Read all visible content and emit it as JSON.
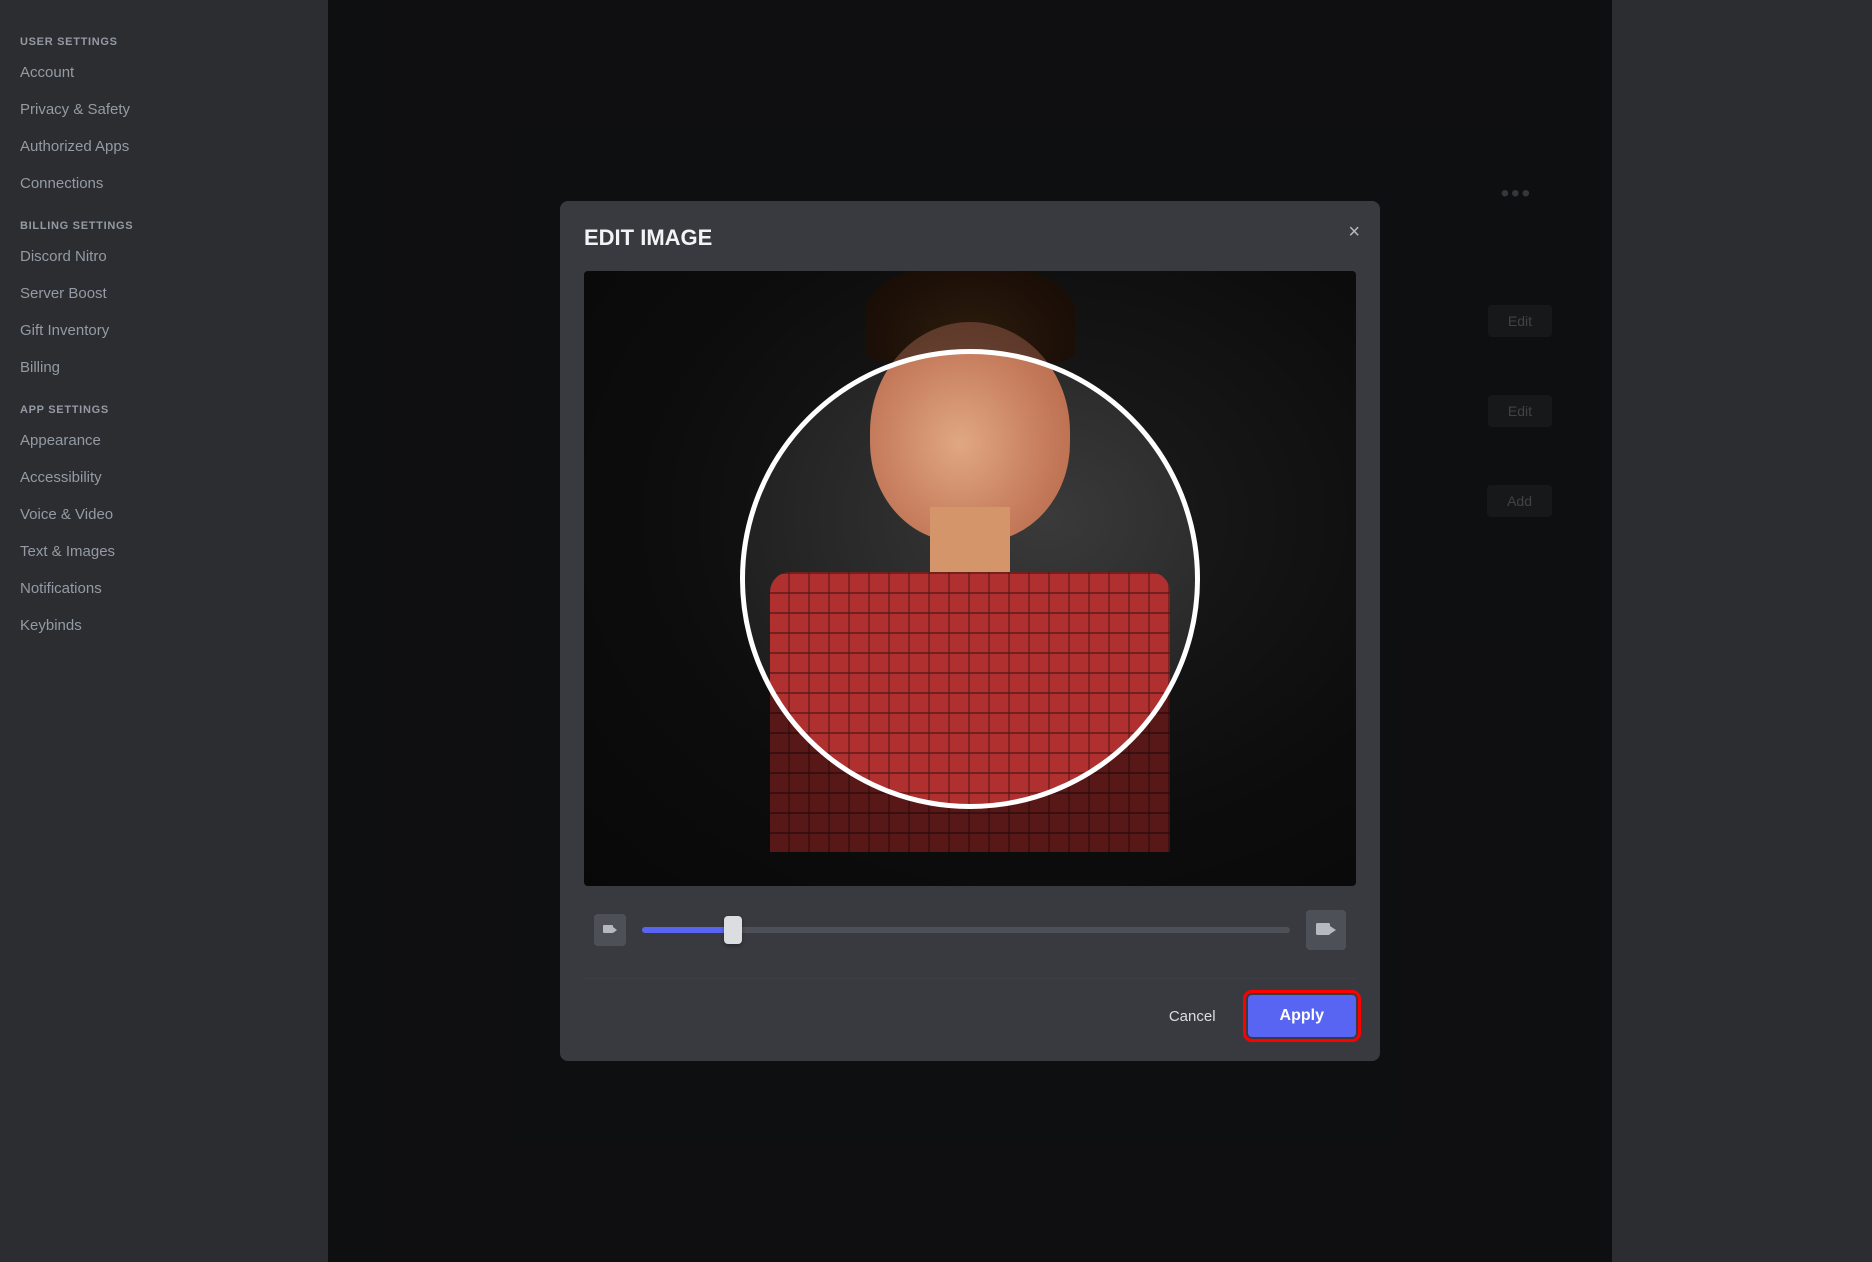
{
  "sidebar": {
    "sections": [
      {
        "label": "USER SETTINGS",
        "items": [
          {
            "id": "account",
            "label": "Account",
            "active": false
          },
          {
            "id": "privacy",
            "label": "Privacy & Safety",
            "active": false
          },
          {
            "id": "apps",
            "label": "Authorized Apps",
            "active": false
          },
          {
            "id": "connections",
            "label": "Connections",
            "active": false
          }
        ]
      },
      {
        "label": "BILLING SETTINGS",
        "items": [
          {
            "id": "nitro",
            "label": "Discord Nitro",
            "active": false
          },
          {
            "id": "boost",
            "label": "Server Boost",
            "active": false
          },
          {
            "id": "inventory",
            "label": "Gift Inventory",
            "active": false
          },
          {
            "id": "billing",
            "label": "Billing",
            "active": false
          }
        ]
      },
      {
        "label": "APP SETTINGS",
        "items": [
          {
            "id": "appearance",
            "label": "Appearance",
            "active": false
          },
          {
            "id": "accessibility",
            "label": "Accessibility",
            "active": false
          },
          {
            "id": "voice",
            "label": "Voice & Video",
            "active": false
          },
          {
            "id": "text",
            "label": "Text & Images",
            "active": false
          },
          {
            "id": "notifications",
            "label": "Notifications",
            "active": false
          },
          {
            "id": "keybinds",
            "label": "Keybinds",
            "active": false
          }
        ]
      }
    ]
  },
  "modal": {
    "title": "EDIT IMAGE",
    "close_label": "×",
    "image_alt": "Profile photo of a young man in a red plaid shirt",
    "slider": {
      "value": 15,
      "min": 0,
      "max": 100
    },
    "buttons": {
      "cancel_label": "Cancel",
      "apply_label": "Apply"
    }
  },
  "panel": {
    "dots_label": "•••",
    "edit1_label": "Edit",
    "edit2_label": "Edit",
    "add_label": "Add"
  }
}
